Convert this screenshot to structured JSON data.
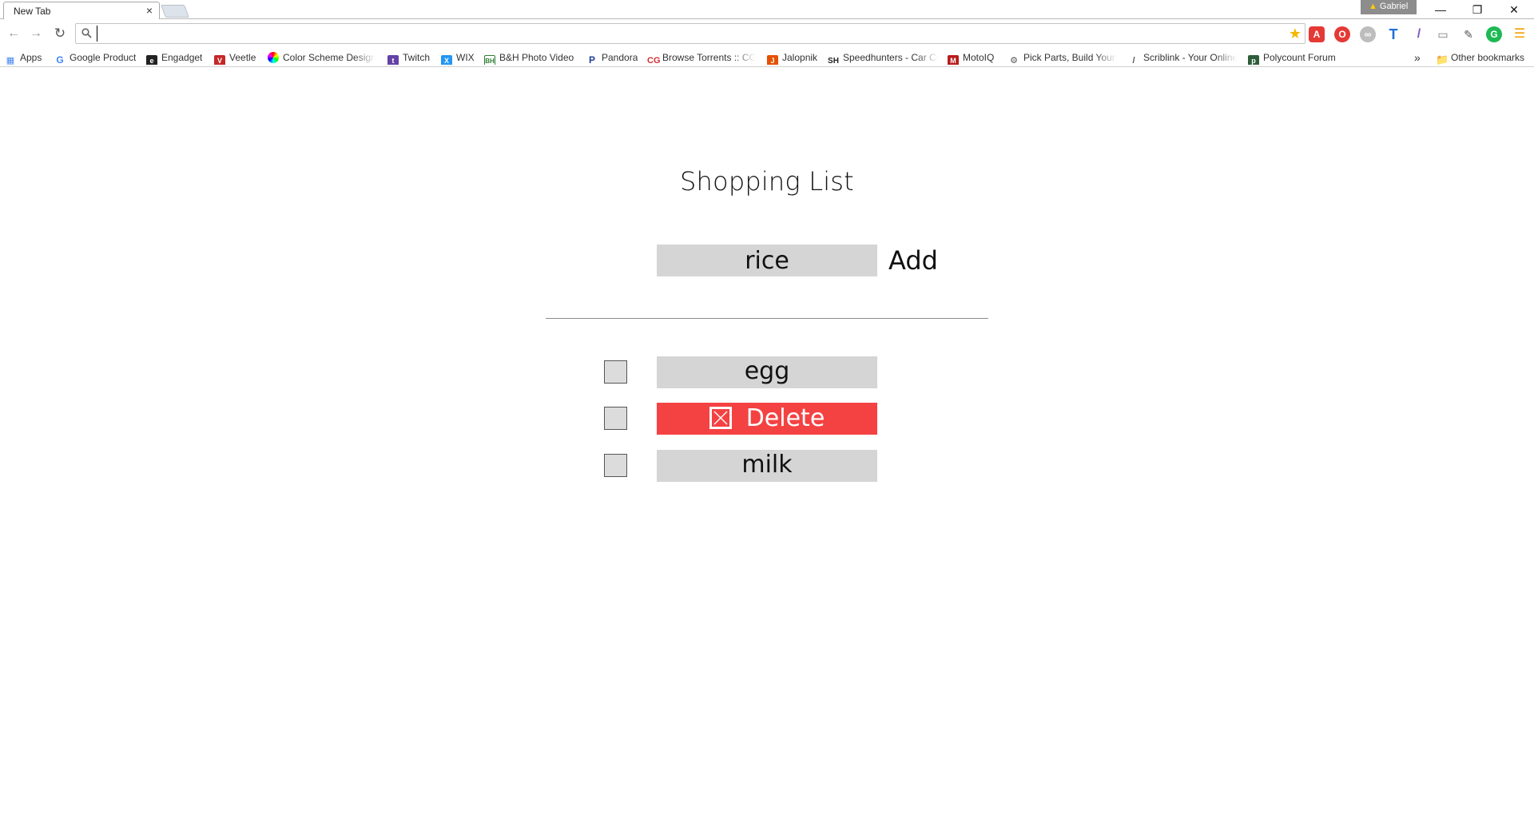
{
  "browser": {
    "tab_title": "New Tab",
    "tab_close": "×",
    "profile_name": "Gabriel",
    "address_value": "",
    "colors": {
      "accent_delete": "#f44242",
      "input_bg": "#d5d5d5"
    }
  },
  "bookmarks": {
    "items": [
      {
        "label": "Apps",
        "icon": "apps-grid-icon"
      },
      {
        "label": "Google Product",
        "icon": "google-icon"
      },
      {
        "label": "Engadget",
        "icon": "engadget-icon"
      },
      {
        "label": "Veetle",
        "icon": "veetle-icon"
      },
      {
        "label": "Color Scheme Design",
        "icon": "color-wheel-icon"
      },
      {
        "label": "Twitch",
        "icon": "twitch-icon"
      },
      {
        "label": "WIX",
        "icon": "wix-icon"
      },
      {
        "label": "B&H Photo Video",
        "icon": "bh-icon"
      },
      {
        "label": "Pandora",
        "icon": "pandora-icon"
      },
      {
        "label": "Browse Torrents :: CGP",
        "icon": "cg-icon"
      },
      {
        "label": "Jalopnik",
        "icon": "jalopnik-icon"
      },
      {
        "label": "Speedhunters - Car Cu",
        "icon": "speedhunters-icon"
      },
      {
        "label": "MotoIQ",
        "icon": "motoiq-icon"
      },
      {
        "label": "Pick Parts, Build Your I",
        "icon": "pcpartpicker-icon"
      },
      {
        "label": "Scriblink - Your Online",
        "icon": "scriblink-icon"
      },
      {
        "label": "Polycount Forum",
        "icon": "polycount-icon"
      }
    ],
    "overflow": "»",
    "other_bookmarks": "Other bookmarks"
  },
  "app": {
    "title": "Shopping List",
    "new_item_value": "rice",
    "add_label": "Add",
    "items": [
      {
        "label": "egg",
        "checked": false
      },
      {
        "label": "Delete",
        "checked": false,
        "hovered_delete": true
      },
      {
        "label": "milk",
        "checked": false
      }
    ]
  }
}
